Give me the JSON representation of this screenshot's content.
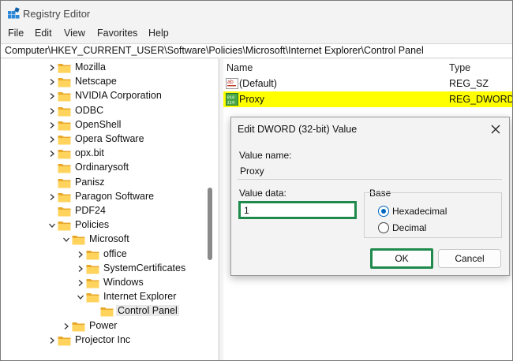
{
  "app": {
    "title": "Registry Editor"
  },
  "menu": [
    "File",
    "Edit",
    "View",
    "Favorites",
    "Help"
  ],
  "address": "Computer\\HKEY_CURRENT_USER\\Software\\Policies\\Microsoft\\Internet Explorer\\Control Panel",
  "tree": [
    {
      "label": "Mozilla",
      "chevron": "right"
    },
    {
      "label": "Netscape",
      "chevron": "right"
    },
    {
      "label": "NVIDIA Corporation",
      "chevron": "right"
    },
    {
      "label": "ODBC",
      "chevron": "right"
    },
    {
      "label": "OpenShell",
      "chevron": "right"
    },
    {
      "label": "Opera Software",
      "chevron": "right"
    },
    {
      "label": "opx.bit",
      "chevron": "right"
    },
    {
      "label": "Ordinarysoft",
      "chevron": "none"
    },
    {
      "label": "Panisz",
      "chevron": "none"
    },
    {
      "label": "Paragon Software",
      "chevron": "right"
    },
    {
      "label": "PDF24",
      "chevron": "none"
    },
    {
      "label": "Policies",
      "chevron": "down"
    },
    {
      "label": "Microsoft",
      "chevron": "down"
    },
    {
      "label": "office",
      "chevron": "right"
    },
    {
      "label": "SystemCertificates",
      "chevron": "right"
    },
    {
      "label": "Windows",
      "chevron": "right"
    },
    {
      "label": "Internet Explorer",
      "chevron": "down"
    },
    {
      "label": "Control Panel",
      "chevron": "none",
      "selected": true
    },
    {
      "label": "Power",
      "chevron": "right"
    },
    {
      "label": "Projector Inc",
      "chevron": "right"
    }
  ],
  "list": {
    "columns": {
      "name": "Name",
      "type": "Type"
    },
    "rows": [
      {
        "icon": "string-value-icon",
        "name": "(Default)",
        "type": "REG_SZ"
      },
      {
        "icon": "dword-value-icon",
        "name": "Proxy",
        "type": "REG_DWORD",
        "highlight_color": "#ffff00"
      }
    ]
  },
  "dialog": {
    "title": "Edit DWORD (32-bit) Value",
    "value_name_label": "Value name:",
    "value_name": "Proxy",
    "value_data_label": "Value data:",
    "value_data": "1",
    "base_label": "Base",
    "base_options": [
      {
        "label": "Hexadecimal",
        "checked": true
      },
      {
        "label": "Decimal",
        "checked": false
      }
    ],
    "ok_label": "OK",
    "cancel_label": "Cancel",
    "highlight_color": "#1f8a4c"
  }
}
